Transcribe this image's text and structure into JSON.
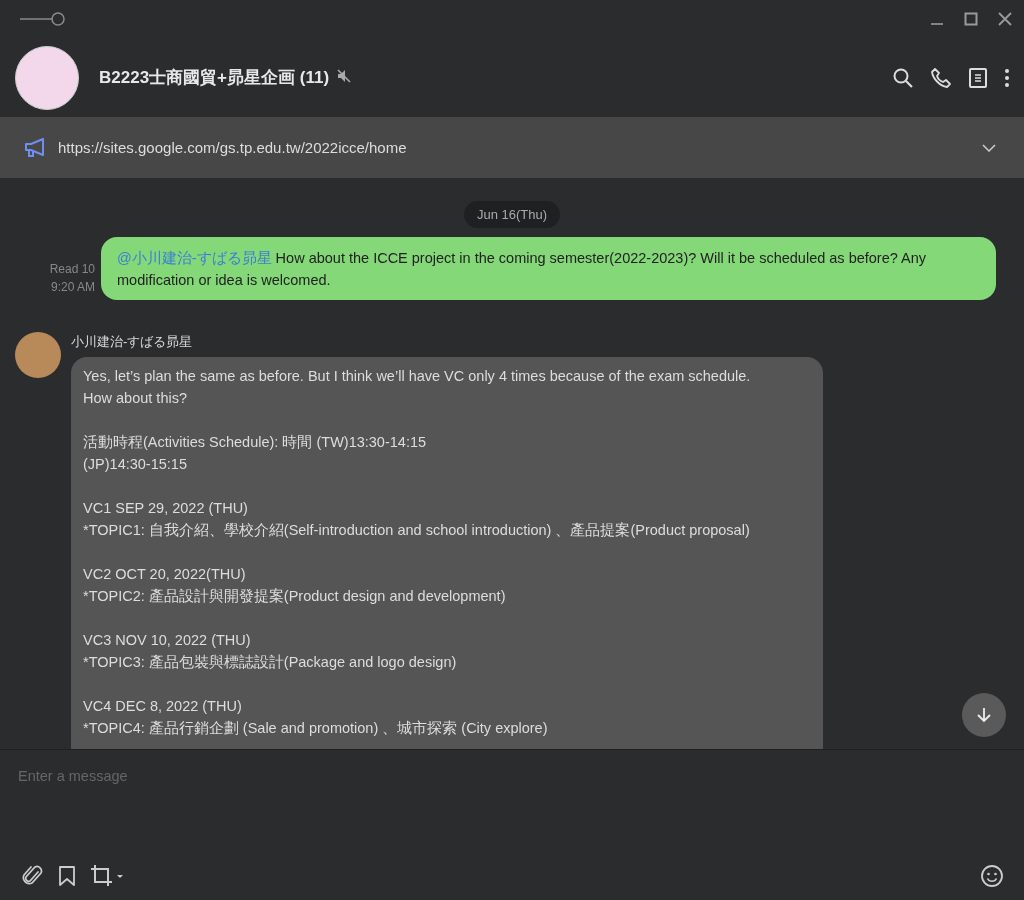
{
  "chat": {
    "title": "B2223士商國貿+昴星企画 (11)",
    "muted": true
  },
  "announcement": {
    "text": "https://sites.google.com/gs.tp.edu.tw/2022icce/home"
  },
  "date_divider": "Jun 16(Thu)",
  "messages": [
    {
      "kind": "outgoing",
      "read": "Read 10",
      "time": "9:20 AM",
      "mention": "@小川建治-すばる昴星",
      "text": "How about the ICCE project in the coming semester(2022-2023)? Will it be scheduled as before? Any modification or idea is welcomed."
    },
    {
      "kind": "incoming",
      "sender": "小川建治-すばる昴星",
      "paragraphs": [
        [
          "Yes, let’s plan the same as before. But I think we’ll have VC only 4 times because of the exam schedule.",
          "How about this?"
        ],
        [
          "活動時程(Activities Schedule): 時間 (TW)13:30-14:15",
          "(JP)14:30-15:15"
        ],
        [
          "VC1 SEP 29, 2022 (THU)",
          "*TOPIC1: 自我介紹、學校介紹(Self-introduction and school introduction) 、產品提案(Product proposal)"
        ],
        [
          "VC2 OCT 20, 2022(THU)",
          "*TOPIC2: 產品設計與開發提案(Product design and development)"
        ],
        [
          "VC3 NOV 10, 2022 (THU)",
          "*TOPIC3: 產品包裝與標誌設計(Package and logo design)"
        ],
        [
          "VC4 DEC 8, 2022 (THU)",
          "*TOPIC4: 產品行銷企劃 (Sale and promotion) 、城市探索 (City explore)"
        ]
      ]
    }
  ],
  "composer": {
    "placeholder": "Enter a message"
  }
}
